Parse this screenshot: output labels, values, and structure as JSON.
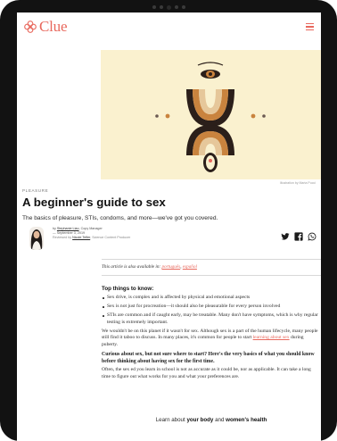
{
  "header": {
    "brand": "Clue",
    "accent_color": "#e8685d",
    "menu_icon": "hamburger-icon"
  },
  "hero": {
    "background_color": "#faf1cf",
    "credit": "Illustration by Marta Pucci"
  },
  "article": {
    "kicker": "PLEASURE",
    "title": "A beginner's guide to sex",
    "subtitle": "The basics of pleasure, STIs, condoms, and more—we've got you covered.",
    "author": {
      "by_prefix": "by ",
      "name": "Stephanie Liao",
      "role": ", Copy Manager",
      "date": "— September 3, 2019",
      "reviewed_prefix": "Reviewed by ",
      "reviewer": "Nicole Telfer",
      "reviewer_role": ", Science Content Producer"
    },
    "share_icons": [
      "twitter-icon",
      "facebook-icon",
      "whatsapp-icon"
    ],
    "available_prefix": "This article is also available in: ",
    "available_languages": [
      "português",
      "español"
    ],
    "top_things_heading": "Top things to know:",
    "top_things": [
      "Sex drive, is complex and is affected by physical and emotional aspects",
      "Sex is not just for procreation—it should also be pleasurable for every person involved",
      "STIs are common and if caught early, may be treatable. Many don't have symptoms, which is why regular testing is extremely important."
    ],
    "para1_prefix": "We wouldn't be on this planet if it wasn't for sex. Although sex is a part of the human lifecycle, many people still find it taboo to discuss. In many places, it's common for people to start ",
    "para1_link": "learning about sex",
    "para1_suffix": " during puberty.",
    "bold_para": "Curious about sex, but not sure where to start? Here's the very basics of what you should know before thinking about having sex for the first time.",
    "para2": "Often, the sex ed you learn in school is not as accurate as it could be, nor as applicable. It can take a long time to figure out what works for you and what your preferences are.",
    "learn_prefix": "Learn about ",
    "learn_link1": "your body",
    "learn_mid": " and ",
    "learn_link2": "women's health"
  }
}
